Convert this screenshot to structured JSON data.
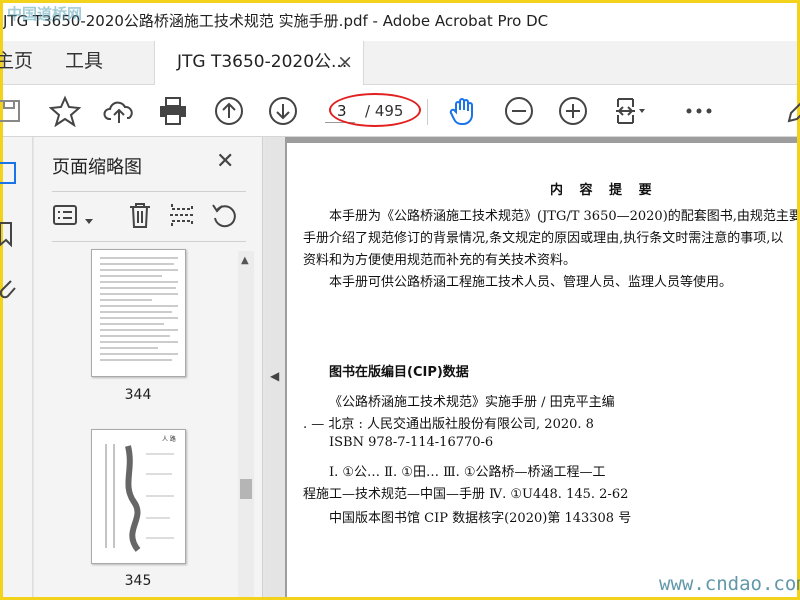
{
  "window": {
    "title": "JTG T3650-2020公路桥涵施工技术规范 实施手册.pdf - Adobe Acrobat Pro DC"
  },
  "menu": {
    "home": "主页",
    "tools": "工具"
  },
  "tab": {
    "label": "JTG T3650-2020公...",
    "close": "×"
  },
  "pagination": {
    "current": "3",
    "total": "/ 495"
  },
  "panel": {
    "title": "页面缩略图",
    "close": "✕",
    "thumbnails": [
      {
        "label": "344"
      },
      {
        "label": "345"
      }
    ],
    "thumb_header": "人  路"
  },
  "document": {
    "heading": "内 容 提 要",
    "summary_lines": [
      "本手册为《公路桥涵施工技术规范》(JTG/T 3650—2020)的配套图书,由规范主要起",
      "手册介绍了规范修订的背景情况,条文规定的原因或理由,执行条文时需注意的事项,以",
      "资料和为方便使用规范而补充的有关技术资料。",
      "本手册可供公路桥涵工程施工技术人员、管理人员、监理人员等使用。"
    ],
    "cip_title": "图书在版编目(CIP)数据",
    "cip_lines": [
      "《公路桥涵施工技术规范》实施手册 / 田克平主编",
      ". — 北京 : 人民交通出版社股份有限公司, 2020. 8",
      "ISBN 978-7-114-16770-6",
      "Ⅰ. ①公…   Ⅱ. ①田…   Ⅲ. ①公路桥—桥涵工程—工",
      "程施工—技术规范—中国—手册   Ⅳ. ①U448. 145. 2-62",
      "中国版本图书馆 CIP 数据核字(2020)第 143308 号"
    ]
  },
  "watermarks": {
    "top_left": "中国道桥网",
    "bottom_right": "www.cndao.com"
  },
  "colors": {
    "accent_blue": "#1a73e8",
    "annotation_red": "#e22020",
    "border_yellow": "#f3d21b"
  }
}
